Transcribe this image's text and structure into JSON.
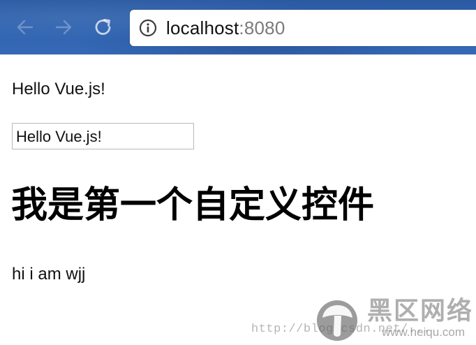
{
  "browser": {
    "url_host": "localhost",
    "url_port": ":8080",
    "icons": {
      "back": "arrow-left-icon",
      "forward": "arrow-right-icon",
      "reload": "reload-icon",
      "site_info": "info-circle-icon"
    },
    "toolbar_color": "#2f63b0"
  },
  "app": {
    "message_text": "Hello Vue.js!",
    "message_input_value": "Hello Vue.js!",
    "component_heading": "我是第一个自定义控件",
    "component_text": "hi i am wjj"
  },
  "watermark": {
    "source_url": "http://blog.csdn.net/...",
    "brand": "黑区网络",
    "domain": "www.heiqu.com",
    "logo_icon": "mushroom-logo-icon"
  }
}
